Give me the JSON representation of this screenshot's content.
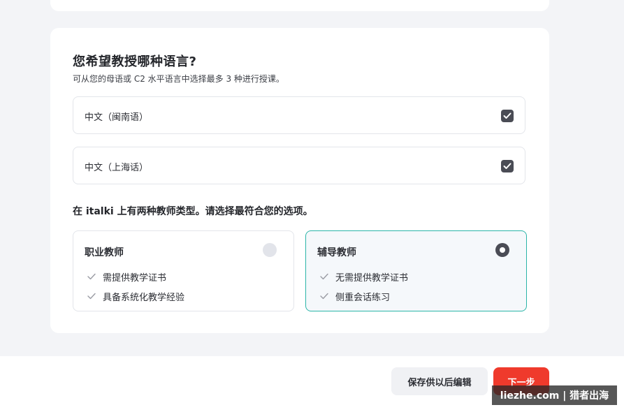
{
  "question": {
    "title": "您希望教授哪种语言?",
    "subtitle": "可从您的母语或 C2 水平语言中选择最多 3 种进行授课。"
  },
  "languages": [
    {
      "label": "中文（闽南语）",
      "checked": true
    },
    {
      "label": "中文（上海话）",
      "checked": true
    }
  ],
  "teacher_type": {
    "title": "在 italki 上有两种教师类型。请选择最符合您的选项。",
    "options": [
      {
        "name": "职业教师",
        "selected": false,
        "features": [
          "需提供教学证书",
          "具备系统化教学经验"
        ]
      },
      {
        "name": "辅导教师",
        "selected": true,
        "features": [
          "无需提供教学证书",
          "侧重会话练习"
        ]
      }
    ]
  },
  "footer": {
    "save_label": "保存供以后编辑",
    "next_label": "下一步"
  },
  "watermark": "liezhe.com | 猎者出海",
  "colors": {
    "accent": "#ef3a2c",
    "selected_border": "#2bb5a8",
    "checkbox": "#4a4c55"
  }
}
